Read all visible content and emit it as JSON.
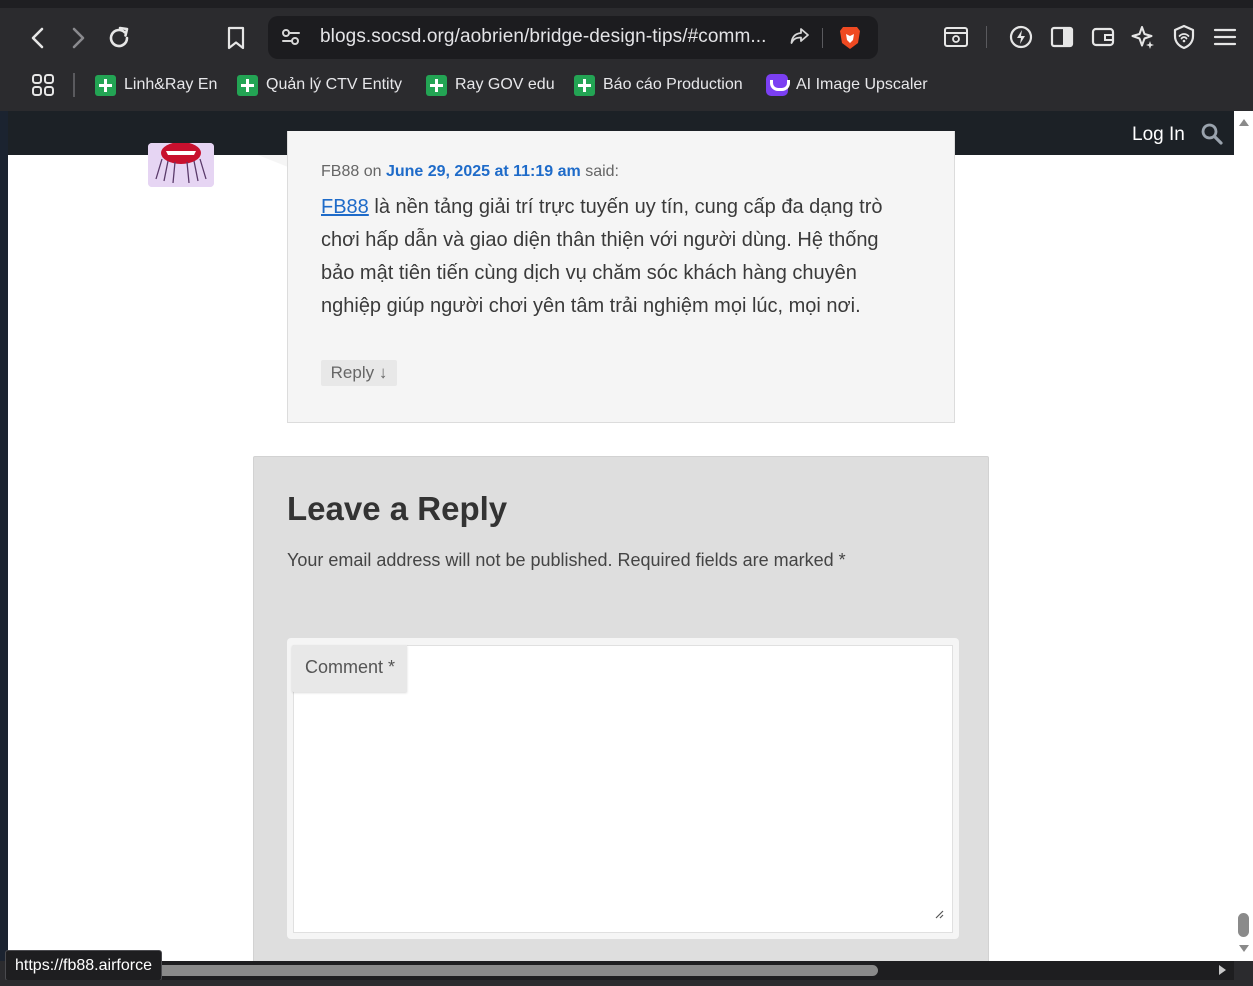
{
  "browser": {
    "url": "blogs.socsd.org/aobrien/bridge-design-tips/#comm...",
    "status_url": "https://fb88.airforce",
    "bookmarks": [
      {
        "label": "Linh&Ray En",
        "icon": "sheets-icon"
      },
      {
        "label": "Quản lý CTV Entity",
        "icon": "sheets-icon"
      },
      {
        "label": "Ray GOV edu",
        "icon": "sheets-icon"
      },
      {
        "label": "Báo cáo Production",
        "icon": "sheets-icon"
      },
      {
        "label": "AI Image Upscaler",
        "icon": "upscaler-icon"
      }
    ]
  },
  "site_header": {
    "login_label": "Log In"
  },
  "comment": {
    "author": "FB88",
    "on_text": "on",
    "date": "June 29, 2025 at 11:19 am",
    "said_text": "said:",
    "link_text": "FB88",
    "body": " là nền tảng giải trí trực tuyến uy tín, cung cấp đa dạng trò chơi hấp dẫn và giao diện thân thiện với người dùng. Hệ thống bảo mật tiên tiến cùng dịch vụ chăm sóc khách hàng chuyên nghiệp giúp người chơi yên tâm trải nghiệm mọi lúc, mọi nơi.",
    "reply_label": "Reply ↓"
  },
  "respond": {
    "title": "Leave a Reply",
    "notes": "Your email address will not be published. Required fields are marked *",
    "comment_label": "Comment *"
  },
  "colors": {
    "accent_link": "#1e6bc9",
    "header_bg": "#1c2126",
    "chrome_bg": "#2b2b2e",
    "sheets_green": "#23a454",
    "upscaler_purple": "#7b3ff2"
  }
}
